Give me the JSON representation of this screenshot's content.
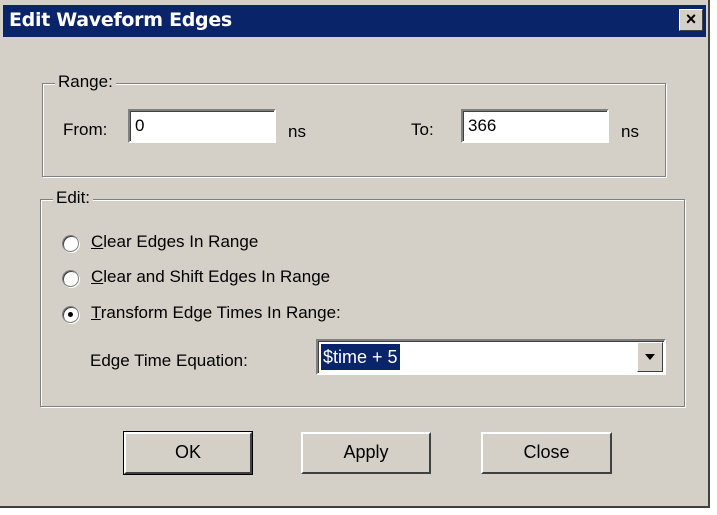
{
  "window": {
    "title": "Edit Waveform Edges",
    "close_glyph": "×"
  },
  "range": {
    "legend": "Range:",
    "from_label": "From:",
    "from_value": "0",
    "from_unit": "ns",
    "to_label": "To:",
    "to_value": "366",
    "to_unit": "ns"
  },
  "edit": {
    "legend": "Edit:",
    "options": [
      {
        "first": "C",
        "rest": "lear Edges In Range",
        "checked": false
      },
      {
        "first": "C",
        "rest": "lear and Shift Edges In Range",
        "checked": false
      },
      {
        "first": "T",
        "rest": "ransform Edge Times In Range:",
        "checked": true
      }
    ],
    "equation_label": "Edge Time Equation:",
    "equation_value": "$time + 5"
  },
  "buttons": {
    "ok": "OK",
    "apply": "Apply",
    "close": "Close"
  }
}
